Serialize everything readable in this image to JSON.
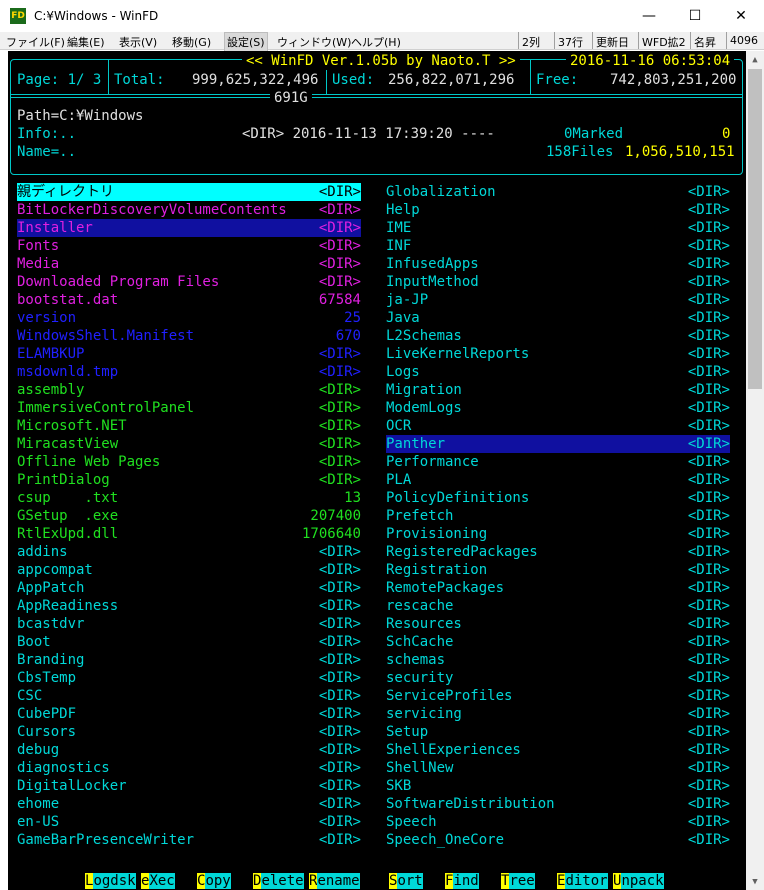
{
  "window": {
    "icon_text": "FD",
    "title": "C:¥Windows - WinFD",
    "minimize": "—",
    "maximize": "☐",
    "close": "✕"
  },
  "menu": {
    "items": [
      "ファイル(F)",
      "編集(E)",
      "表示(V)",
      "移動(G)",
      "設定(S)",
      "ウィンドウ(W)",
      "ヘルプ(H)"
    ],
    "status": [
      "2列",
      "37行",
      "更新日",
      "WFD拡2",
      "名昇",
      "4096"
    ]
  },
  "header": {
    "banner": "<< WinFD Ver.1.05b by Naoto.T >>",
    "datetime": "2016-11-16 06:53:04",
    "page_label": "Page: 1/ 3",
    "total_label": "Total:",
    "total_value": "999,625,322,496",
    "total_short": "691G",
    "used_label": "Used:",
    "used_value": "256,822,071,296",
    "free_label": "Free:",
    "free_value": "742,803,251,200",
    "path": "Path=C:¥Windows",
    "info_label": "Info:..",
    "info_detail": "<DIR> 2016-11-13 17:39:20 ----",
    "marked_label": "0Marked",
    "marked_value": "0",
    "name_label": "Name=..",
    "files_label": "158Files",
    "files_size": "1,056,510,151"
  },
  "colors": {
    "console_bg": "#000000",
    "cyan": "#00d8d8",
    "magenta": "#e020e0",
    "blue": "#2020ff",
    "green": "#20e020",
    "selection_bg": "#1010a0",
    "parent_bg": "#00ffff"
  },
  "left_column": [
    {
      "name": "親ディレクトリ",
      "size": "<DIR>",
      "color": "parent"
    },
    {
      "name": "BitLockerDiscoveryVolumeContents",
      "size": "<DIR>",
      "color": "magenta"
    },
    {
      "name": "Installer",
      "size": "<DIR>",
      "color": "magenta",
      "selected": true
    },
    {
      "name": "Fonts",
      "size": "<DIR>",
      "color": "magenta"
    },
    {
      "name": "Media",
      "size": "<DIR>",
      "color": "magenta"
    },
    {
      "name": "Downloaded Program Files",
      "size": "<DIR>",
      "color": "magenta"
    },
    {
      "name": "bootstat.dat",
      "size": "67584",
      "color": "magenta"
    },
    {
      "name": "version",
      "size": "25",
      "color": "blue"
    },
    {
      "name": "WindowsShell.Manifest",
      "size": "670",
      "color": "blue"
    },
    {
      "name": "ELAMBKUP",
      "size": "<DIR>",
      "color": "blue"
    },
    {
      "name": "msdownld.tmp",
      "size": "<DIR>",
      "color": "blue"
    },
    {
      "name": "assembly",
      "size": "<DIR>",
      "color": "green"
    },
    {
      "name": "ImmersiveControlPanel",
      "size": "<DIR>",
      "color": "green"
    },
    {
      "name": "Microsoft.NET",
      "size": "<DIR>",
      "color": "green"
    },
    {
      "name": "MiracastView",
      "size": "<DIR>",
      "color": "green"
    },
    {
      "name": "Offline Web Pages",
      "size": "<DIR>",
      "color": "green"
    },
    {
      "name": "PrintDialog",
      "size": "<DIR>",
      "color": "green"
    },
    {
      "name": "csup    .txt",
      "size": "13",
      "color": "green"
    },
    {
      "name": "GSetup  .exe",
      "size": "207400",
      "color": "green"
    },
    {
      "name": "RtlExUpd.dll",
      "size": "1706640",
      "color": "green"
    },
    {
      "name": "addins",
      "size": "<DIR>",
      "color": "cyan"
    },
    {
      "name": "appcompat",
      "size": "<DIR>",
      "color": "cyan"
    },
    {
      "name": "AppPatch",
      "size": "<DIR>",
      "color": "cyan"
    },
    {
      "name": "AppReadiness",
      "size": "<DIR>",
      "color": "cyan"
    },
    {
      "name": "bcastdvr",
      "size": "<DIR>",
      "color": "cyan"
    },
    {
      "name": "Boot",
      "size": "<DIR>",
      "color": "cyan"
    },
    {
      "name": "Branding",
      "size": "<DIR>",
      "color": "cyan"
    },
    {
      "name": "CbsTemp",
      "size": "<DIR>",
      "color": "cyan"
    },
    {
      "name": "CSC",
      "size": "<DIR>",
      "color": "cyan"
    },
    {
      "name": "CubePDF",
      "size": "<DIR>",
      "color": "cyan"
    },
    {
      "name": "Cursors",
      "size": "<DIR>",
      "color": "cyan"
    },
    {
      "name": "debug",
      "size": "<DIR>",
      "color": "cyan"
    },
    {
      "name": "diagnostics",
      "size": "<DIR>",
      "color": "cyan"
    },
    {
      "name": "DigitalLocker",
      "size": "<DIR>",
      "color": "cyan"
    },
    {
      "name": "ehome",
      "size": "<DIR>",
      "color": "cyan"
    },
    {
      "name": "en-US",
      "size": "<DIR>",
      "color": "cyan"
    },
    {
      "name": "GameBarPresenceWriter",
      "size": "<DIR>",
      "color": "cyan"
    }
  ],
  "right_column": [
    {
      "name": "Globalization",
      "size": "<DIR>",
      "color": "cyan"
    },
    {
      "name": "Help",
      "size": "<DIR>",
      "color": "cyan"
    },
    {
      "name": "IME",
      "size": "<DIR>",
      "color": "cyan"
    },
    {
      "name": "INF",
      "size": "<DIR>",
      "color": "cyan"
    },
    {
      "name": "InfusedApps",
      "size": "<DIR>",
      "color": "cyan"
    },
    {
      "name": "InputMethod",
      "size": "<DIR>",
      "color": "cyan"
    },
    {
      "name": "ja-JP",
      "size": "<DIR>",
      "color": "cyan"
    },
    {
      "name": "Java",
      "size": "<DIR>",
      "color": "cyan"
    },
    {
      "name": "L2Schemas",
      "size": "<DIR>",
      "color": "cyan"
    },
    {
      "name": "LiveKernelReports",
      "size": "<DIR>",
      "color": "cyan"
    },
    {
      "name": "Logs",
      "size": "<DIR>",
      "color": "cyan"
    },
    {
      "name": "Migration",
      "size": "<DIR>",
      "color": "cyan"
    },
    {
      "name": "ModemLogs",
      "size": "<DIR>",
      "color": "cyan"
    },
    {
      "name": "OCR",
      "size": "<DIR>",
      "color": "cyan"
    },
    {
      "name": "Panther",
      "size": "<DIR>",
      "color": "cyan",
      "selected": true
    },
    {
      "name": "Performance",
      "size": "<DIR>",
      "color": "cyan"
    },
    {
      "name": "PLA",
      "size": "<DIR>",
      "color": "cyan"
    },
    {
      "name": "PolicyDefinitions",
      "size": "<DIR>",
      "color": "cyan"
    },
    {
      "name": "Prefetch",
      "size": "<DIR>",
      "color": "cyan"
    },
    {
      "name": "Provisioning",
      "size": "<DIR>",
      "color": "cyan"
    },
    {
      "name": "RegisteredPackages",
      "size": "<DIR>",
      "color": "cyan"
    },
    {
      "name": "Registration",
      "size": "<DIR>",
      "color": "cyan"
    },
    {
      "name": "RemotePackages",
      "size": "<DIR>",
      "color": "cyan"
    },
    {
      "name": "rescache",
      "size": "<DIR>",
      "color": "cyan"
    },
    {
      "name": "Resources",
      "size": "<DIR>",
      "color": "cyan"
    },
    {
      "name": "SchCache",
      "size": "<DIR>",
      "color": "cyan"
    },
    {
      "name": "schemas",
      "size": "<DIR>",
      "color": "cyan"
    },
    {
      "name": "security",
      "size": "<DIR>",
      "color": "cyan"
    },
    {
      "name": "ServiceProfiles",
      "size": "<DIR>",
      "color": "cyan"
    },
    {
      "name": "servicing",
      "size": "<DIR>",
      "color": "cyan"
    },
    {
      "name": "Setup",
      "size": "<DIR>",
      "color": "cyan"
    },
    {
      "name": "ShellExperiences",
      "size": "<DIR>",
      "color": "cyan"
    },
    {
      "name": "ShellNew",
      "size": "<DIR>",
      "color": "cyan"
    },
    {
      "name": "SKB",
      "size": "<DIR>",
      "color": "cyan"
    },
    {
      "name": "SoftwareDistribution",
      "size": "<DIR>",
      "color": "cyan"
    },
    {
      "name": "Speech",
      "size": "<DIR>",
      "color": "cyan"
    },
    {
      "name": "Speech_OneCore",
      "size": "<DIR>",
      "color": "cyan"
    }
  ],
  "function_keys": [
    {
      "key": "L",
      "rest": "ogdsk"
    },
    {
      "key": "e",
      "rest": "X",
      "tail": "ec"
    },
    {
      "key": "C",
      "rest": "opy"
    },
    {
      "key": "D",
      "rest": "elete"
    },
    {
      "key": "R",
      "rest": "ename"
    },
    {
      "key": "S",
      "rest": "ort"
    },
    {
      "key": "F",
      "rest": "ind"
    },
    {
      "key": "T",
      "rest": "ree"
    },
    {
      "key": "E",
      "rest": "ditor"
    },
    {
      "key": "U",
      "rest": "npack"
    }
  ],
  "scrollbar": {
    "up": "▲",
    "down": "▼"
  }
}
